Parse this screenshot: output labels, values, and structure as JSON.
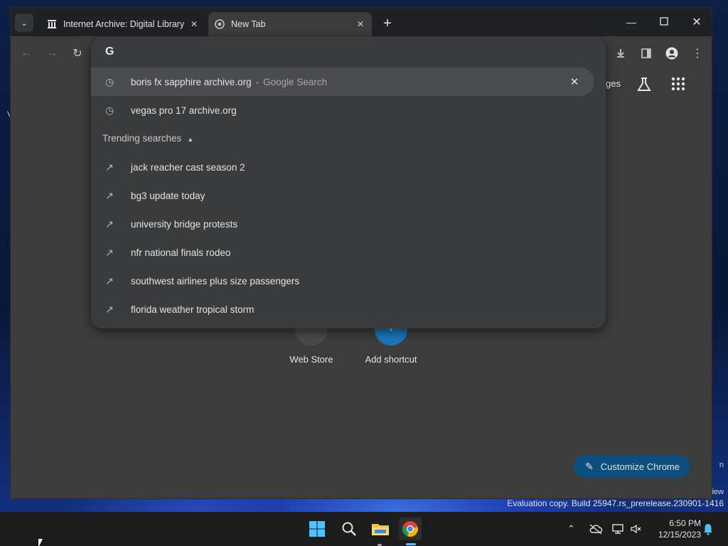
{
  "tabs": [
    {
      "title": "Internet Archive: Digital Library",
      "icon": "archive-icon"
    },
    {
      "title": "New Tab",
      "icon": "chrome-icon"
    }
  ],
  "omnibox": {
    "engine_icon": "G",
    "suggestions": [
      {
        "text": "boris fx sapphire archive.org",
        "separator": "-",
        "sub": "Google Search",
        "icon": "history-icon"
      },
      {
        "text": "vegas pro 17 archive.org",
        "icon": "history-icon"
      }
    ],
    "trending_header": "Trending searches",
    "trending": [
      "jack reacher cast season 2",
      "bg3 update today",
      "university bridge protests",
      "nfr national finals rodeo",
      "southwest airlines plus size passengers",
      "florida weather tropical storm"
    ]
  },
  "ntp": {
    "images_label": "mages",
    "shortcuts": [
      {
        "label": "Web Store"
      },
      {
        "label": "Add shortcut"
      }
    ],
    "customize_label": "Customize Chrome"
  },
  "desktop": {
    "watermark_left": "V",
    "watermark_right1": "n",
    "watermark_right2": "iew",
    "eval_text": "Evaluation copy. Build 25947.rs_prerelease.230901-1416"
  },
  "taskbar": {
    "time": "6:50 PM",
    "date": "12/15/2023"
  },
  "colors": {
    "accent": "#0c4e7d",
    "tab_strip": "#202124",
    "surface": "#3c3c3c",
    "taskbar": "#1c1c1c"
  }
}
